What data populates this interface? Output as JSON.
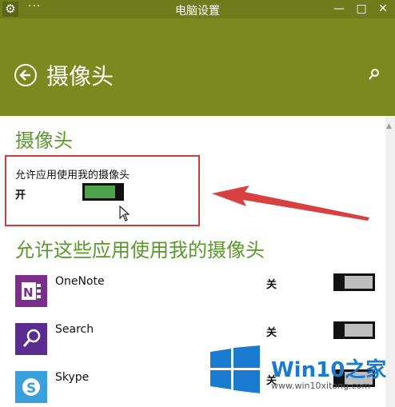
{
  "window": {
    "title": "电脑设置",
    "dots": "···",
    "minimize": "—",
    "maximize": "□",
    "close": "✕"
  },
  "header": {
    "title": "摄像头"
  },
  "camera_section": {
    "heading": "摄像头",
    "allow_label": "允许应用使用我的摄像头",
    "state_label": "开",
    "toggle_on": true
  },
  "apps_section": {
    "heading": "允许这些应用使用我的摄像头",
    "apps": [
      {
        "name": "OneNote",
        "state": "关",
        "on": false
      },
      {
        "name": "Search",
        "state": "关",
        "on": false
      },
      {
        "name": "Skype",
        "state": "关",
        "on": false
      }
    ]
  },
  "watermark": {
    "brand": "Win10",
    "brand_suffix": "之家",
    "domain": "www.win10xitong.com"
  },
  "colors": {
    "titlebar": "#6e7c1c",
    "header": "#7a8a1e",
    "accent_green": "#5a9a2a",
    "toggle_on": "#4aa24a",
    "annotation_red": "#d03a3a",
    "watermark_blue": "#1b7bd0"
  },
  "icons": [
    "gear-icon",
    "back-arrow-icon",
    "search-icon",
    "onenote-icon",
    "search-app-icon",
    "skype-icon",
    "mouse-cursor-icon",
    "windows-logo-icon"
  ]
}
